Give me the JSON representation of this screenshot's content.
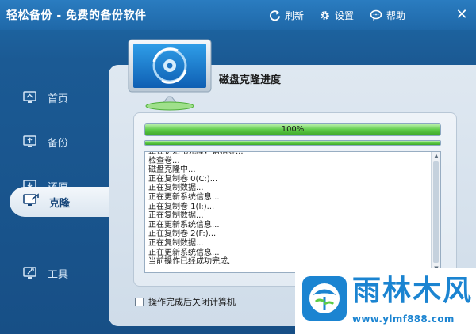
{
  "window": {
    "title": "轻松备份 - 免费的备份软件",
    "refresh_label": "刷新",
    "settings_label": "设置",
    "help_label": "帮助",
    "close_glyph": "✕"
  },
  "sidebar": {
    "items": [
      {
        "label": "首页",
        "icon": "home-monitor-icon"
      },
      {
        "label": "备份",
        "icon": "backup-monitor-icon"
      },
      {
        "label": "还原",
        "icon": "restore-monitor-icon"
      },
      {
        "label": "克隆",
        "icon": "clone-monitor-icon",
        "active": true
      },
      {
        "label": "工具",
        "icon": "tools-monitor-icon"
      }
    ]
  },
  "main": {
    "title": "磁盘克隆进度",
    "progress": {
      "percent": 100,
      "label": "100%"
    },
    "sub_progress": {
      "percent": 100
    },
    "log_lines": [
      "正在初始化克隆，请稍等...",
      "检查卷...",
      "磁盘克隆中...",
      "正在复制卷 0(C:)...",
      "正在复制数据...",
      "正在更新系统信息...",
      "正在复制卷 1(I:)...",
      "正在复制数据...",
      "正在更新系统信息...",
      "正在复制卷 2(F:)...",
      "正在复制数据...",
      "正在更新系统信息...",
      "当前操作已经成功完成."
    ],
    "shutdown_label": "操作完成后关闭计算机"
  },
  "watermark": {
    "brand": "雨林木风",
    "url": "www.ylmf888.com"
  },
  "colors": {
    "accent": "#1b84d1",
    "progress_green": "#5dcb47",
    "titlebar": "#1f68a8"
  }
}
